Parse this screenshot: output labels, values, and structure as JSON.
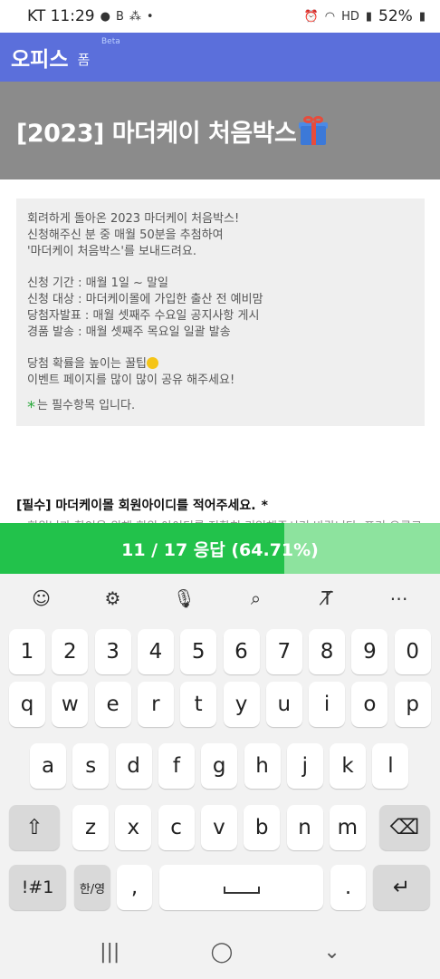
{
  "status_bar": {
    "carrier_time": "KT 11:29",
    "battery": "52%"
  },
  "app": {
    "title": "오피스",
    "subtitle": "폼",
    "badge": "Beta"
  },
  "hero": {
    "title": "[2023] 마더케이 처음박스"
  },
  "description": {
    "lines_1": [
      "회려하게 돌아온 2023 마더케이 처음박스!",
      "신청해주신 분 중 매월 50분을 추첨하여",
      "'마더케이 처음박스'를 보내드려요."
    ],
    "lines_2": [
      "신청 기간 : 매월 1일 ~ 말일",
      "신청 대상 : 마더케이몰에 가입한 출산 전 예비맘",
      "당첨자발표 : 매월 셋째주 수요일 공지사항 게시",
      "경품 발송 : 매월 셋째주 목요일 일괄 발송"
    ],
    "lines_3": [
      "당첨 확률을 높이는 꿀팁",
      "이벤트 페이지를 많이 많이 공유 해주세요!"
    ],
    "required_note": "는 필수항목 입니다."
  },
  "question": {
    "label": "[필수] 마더케이몰 회원아이디를 적어주세요.",
    "required_mark": "*",
    "hint": "회원님과 확인을 위해 회원 아이디를 정확히 기입해주시기 바랍니다. 표기 오류로 인한 대"
  },
  "progress": {
    "label": "11 / 17 응답 (64.71%)",
    "fraction": 0.6471
  },
  "keyboard": {
    "toolbar": [
      "emoji-icon",
      "settings-icon",
      "mic-icon",
      "search-icon",
      "text-edit-icon",
      "more-icon"
    ],
    "row_numbers": [
      "1",
      "2",
      "3",
      "4",
      "5",
      "6",
      "7",
      "8",
      "9",
      "0"
    ],
    "row_top": [
      "q",
      "w",
      "e",
      "r",
      "t",
      "y",
      "u",
      "i",
      "o",
      "p"
    ],
    "row_mid": [
      "a",
      "s",
      "d",
      "f",
      "g",
      "h",
      "j",
      "k",
      "l"
    ],
    "row_bottom": [
      "z",
      "x",
      "c",
      "v",
      "b",
      "n",
      "m"
    ],
    "symbols_label": "!#1",
    "lang_label": "한/영",
    "comma": ",",
    "period": ".",
    "shift_icon": "shift-icon",
    "backspace_icon": "backspace-icon",
    "enter_icon": "enter-icon"
  },
  "nav": [
    "recent-apps-icon",
    "home-icon",
    "back-icon"
  ],
  "colors": {
    "app_bar": "#5b6fdb",
    "hero_bg": "#8b8b8b",
    "progress_fill": "#22c24b",
    "progress_track": "#8de39e",
    "required_star": "#2eaa3f"
  }
}
